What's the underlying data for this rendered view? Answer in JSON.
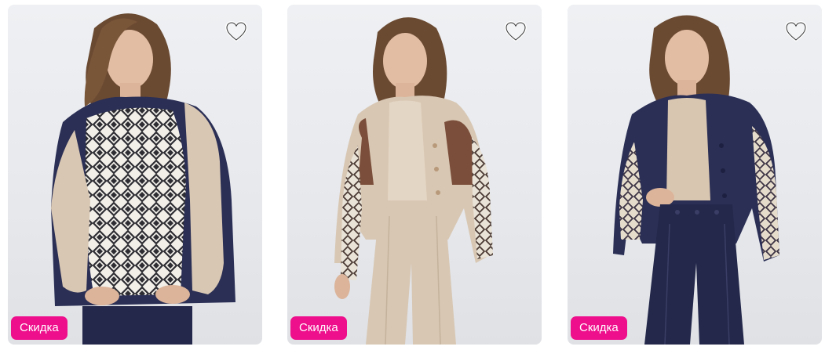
{
  "colors": {
    "badge_bg": "#ee0f8c",
    "navy": "#2b2f55",
    "beige": "#d8c7b3",
    "brown": "#7a4e3a",
    "hair": "#6b4a32",
    "skin": "#e2bda4"
  },
  "products": [
    {
      "badge_label": "Скидка",
      "favorite_icon": "heart-outline-icon"
    },
    {
      "badge_label": "Скидка",
      "favorite_icon": "heart-outline-icon"
    },
    {
      "badge_label": "Скидка",
      "favorite_icon": "heart-outline-icon"
    }
  ]
}
